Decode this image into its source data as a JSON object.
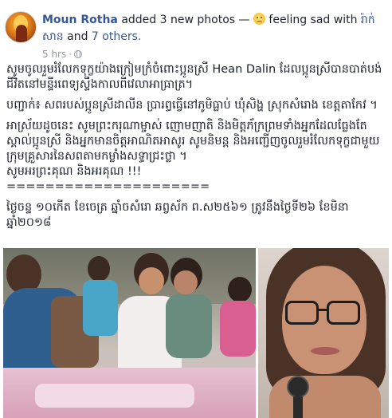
{
  "post": {
    "author": "Moun Rotha",
    "action": "added 3 new photos —",
    "feeling": "feeling sad with",
    "tagged_person": "រ៉ាក់ សាន",
    "others_connector": "and",
    "others": "7 others.",
    "time": "5 hrs",
    "dot": "·",
    "feeling_icon": "sad-emoji",
    "privacy_icon": "globe-icon",
    "paragraphs": [
      "សូមចូលរួមរំលែកទុក្ខយ៉ាងក្រៀមក្រំចំពោះប្អូនស្រី Hean Dalin ដែលប្អូនស្រីបានបាត់បង់ជីវិតនៅមន្ទីរពេទ្យស្ទឹងកាលពីវេលាអាធ្រាត្រ។",
      "បញ្ជាក់៖ សពរបស់ប្អូនស្រីដាលីន ប្រារព្ធធ្វើនៅភូមិធ្លាប់ ឃុំសិង្ហ ស្រុកសំរោង ខេត្តតាកែវ ។",
      "អាស្រ័យដូចនេះ សូមព្រះករុណាម្ចាស់ ញោមញាតិ និងមិត្តភ័ក្រព្រមទាំងអ្នកដែលធ្លែងតែស្គាល់ប្អូនស្រី និងអ្នកមានចិត្តអាណិតអាសូរ សូមនិមន្ត និងអញ្ជើញចូលរួមរំលែកទុក្ខជាមួយក្រុមគ្រួសារនៃសពតាមកម្លាំងសទ្ធាជ្រះថ្លា ។",
      "សូមអរព្រះគុណ និងអរគុណ !!!",
      "=====================",
      "ថ្ងៃចន្ទ ១០កើត ខែចេត្រ ឆ្នាំចសំរោ ឆព្វស័ក ព.ស២៥៦១ ត្រូវនឹងថ្ងៃទី២៦ ខែមិនា ឆ្នាំ២០១៨"
    ]
  },
  "colors": {
    "link": "#365899",
    "meta": "#90949c",
    "text": "#1d2129"
  }
}
